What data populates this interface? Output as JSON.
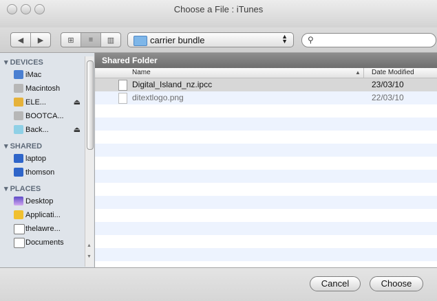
{
  "window": {
    "title": "Choose a File : iTunes"
  },
  "toolbar": {
    "back_icon": "triangle-left",
    "forward_icon": "triangle-right",
    "view_icons": [
      "icon-view",
      "list-view",
      "column-view"
    ],
    "location": "carrier bundle",
    "search_placeholder": ""
  },
  "sidebar": {
    "sections": [
      {
        "label": "DEVICES",
        "items": [
          {
            "label": "iMac",
            "icon": "imac-icon",
            "eject": false
          },
          {
            "label": "Macintosh",
            "icon": "hard-drive-icon",
            "eject": false
          },
          {
            "label": "ELE...",
            "icon": "external-drive-icon",
            "eject": true
          },
          {
            "label": "BOOTCA...",
            "icon": "hard-drive-icon",
            "eject": false
          },
          {
            "label": "Back...",
            "icon": "disk-image-icon",
            "eject": true
          }
        ]
      },
      {
        "label": "SHARED",
        "items": [
          {
            "label": "laptop",
            "icon": "screen-icon",
            "eject": false
          },
          {
            "label": "thomson",
            "icon": "screen-icon",
            "eject": false
          }
        ]
      },
      {
        "label": "PLACES",
        "items": [
          {
            "label": "Desktop",
            "icon": "desktop-icon",
            "eject": false
          },
          {
            "label": "Applicati...",
            "icon": "applications-icon",
            "eject": false
          },
          {
            "label": "thelawre...",
            "icon": "home-icon",
            "eject": false
          },
          {
            "label": "Documents",
            "icon": "documents-icon",
            "eject": false
          }
        ]
      }
    ]
  },
  "main": {
    "header": "Shared Folder",
    "columns": {
      "name": "Name",
      "date": "Date Modified"
    },
    "rows": [
      {
        "name": "Digital_Island_nz.ipcc",
        "date": "23/03/10",
        "selected": true,
        "dim": false
      },
      {
        "name": "ditextlogo.png",
        "date": "22/03/10",
        "selected": false,
        "dim": true
      }
    ]
  },
  "buttons": {
    "cancel": "Cancel",
    "choose": "Choose"
  }
}
